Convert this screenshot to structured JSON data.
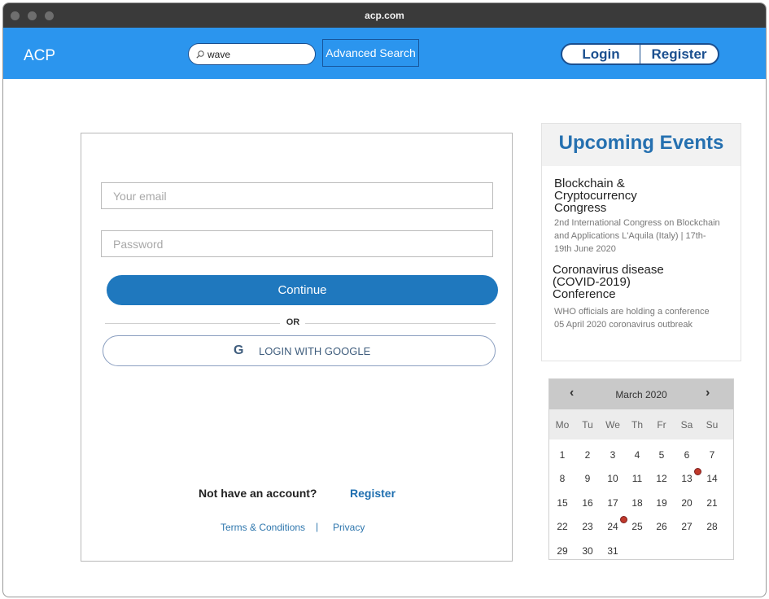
{
  "window": {
    "title": "acp.com"
  },
  "navbar": {
    "brand": "ACP",
    "search": {
      "value": "wave",
      "icon": "search-icon"
    },
    "advanced_search_label": "Advanced Search",
    "login_label": "Login",
    "register_label": "Register"
  },
  "login_form": {
    "email_placeholder": "Your email",
    "password_placeholder": "Password",
    "continue_label": "Continue",
    "divider_label": "OR",
    "google_icon_letter": "G",
    "google_label": "LOGIN WITH GOOGLE",
    "no_account_text": "Not have an account?",
    "register_link": "Register",
    "terms_link": "Terms & Conditions",
    "separator": "|",
    "privacy_link": "Privacy"
  },
  "events": {
    "title": "Upcoming Events",
    "items": [
      {
        "title": "Blockchain & Cryptocurrency Congress",
        "description": "2nd International Congress on Blockchain and Applications L'Aquila (Italy) | 17th-19th June 2020"
      },
      {
        "title": "Coronavirus disease (COVID-2019) Conference",
        "description": "WHO officials are holding a conference 05 April 2020 coronavirus outbreak"
      }
    ]
  },
  "calendar": {
    "month_label": "March 2020",
    "prev_symbol": "‹",
    "next_symbol": "›",
    "weekdays": [
      "Mo",
      "Tu",
      "We",
      "Th",
      "Fr",
      "Sa",
      "Su"
    ],
    "weeks": [
      [
        "1",
        "2",
        "3",
        "4",
        "5",
        "6",
        "7"
      ],
      [
        "8",
        "9",
        "10",
        "11",
        "12",
        "13",
        "14"
      ],
      [
        "15",
        "16",
        "17",
        "18",
        "19",
        "20",
        "21"
      ],
      [
        "22",
        "23",
        "24",
        "25",
        "26",
        "27",
        "28"
      ],
      [
        "29",
        "30",
        "31"
      ]
    ],
    "event_days": [
      "13",
      "24"
    ],
    "event_color": "#c0392b"
  },
  "colors": {
    "navbar": "#2b95ee",
    "accent": "#1f78be",
    "titlebar": "#3a3a3a"
  }
}
